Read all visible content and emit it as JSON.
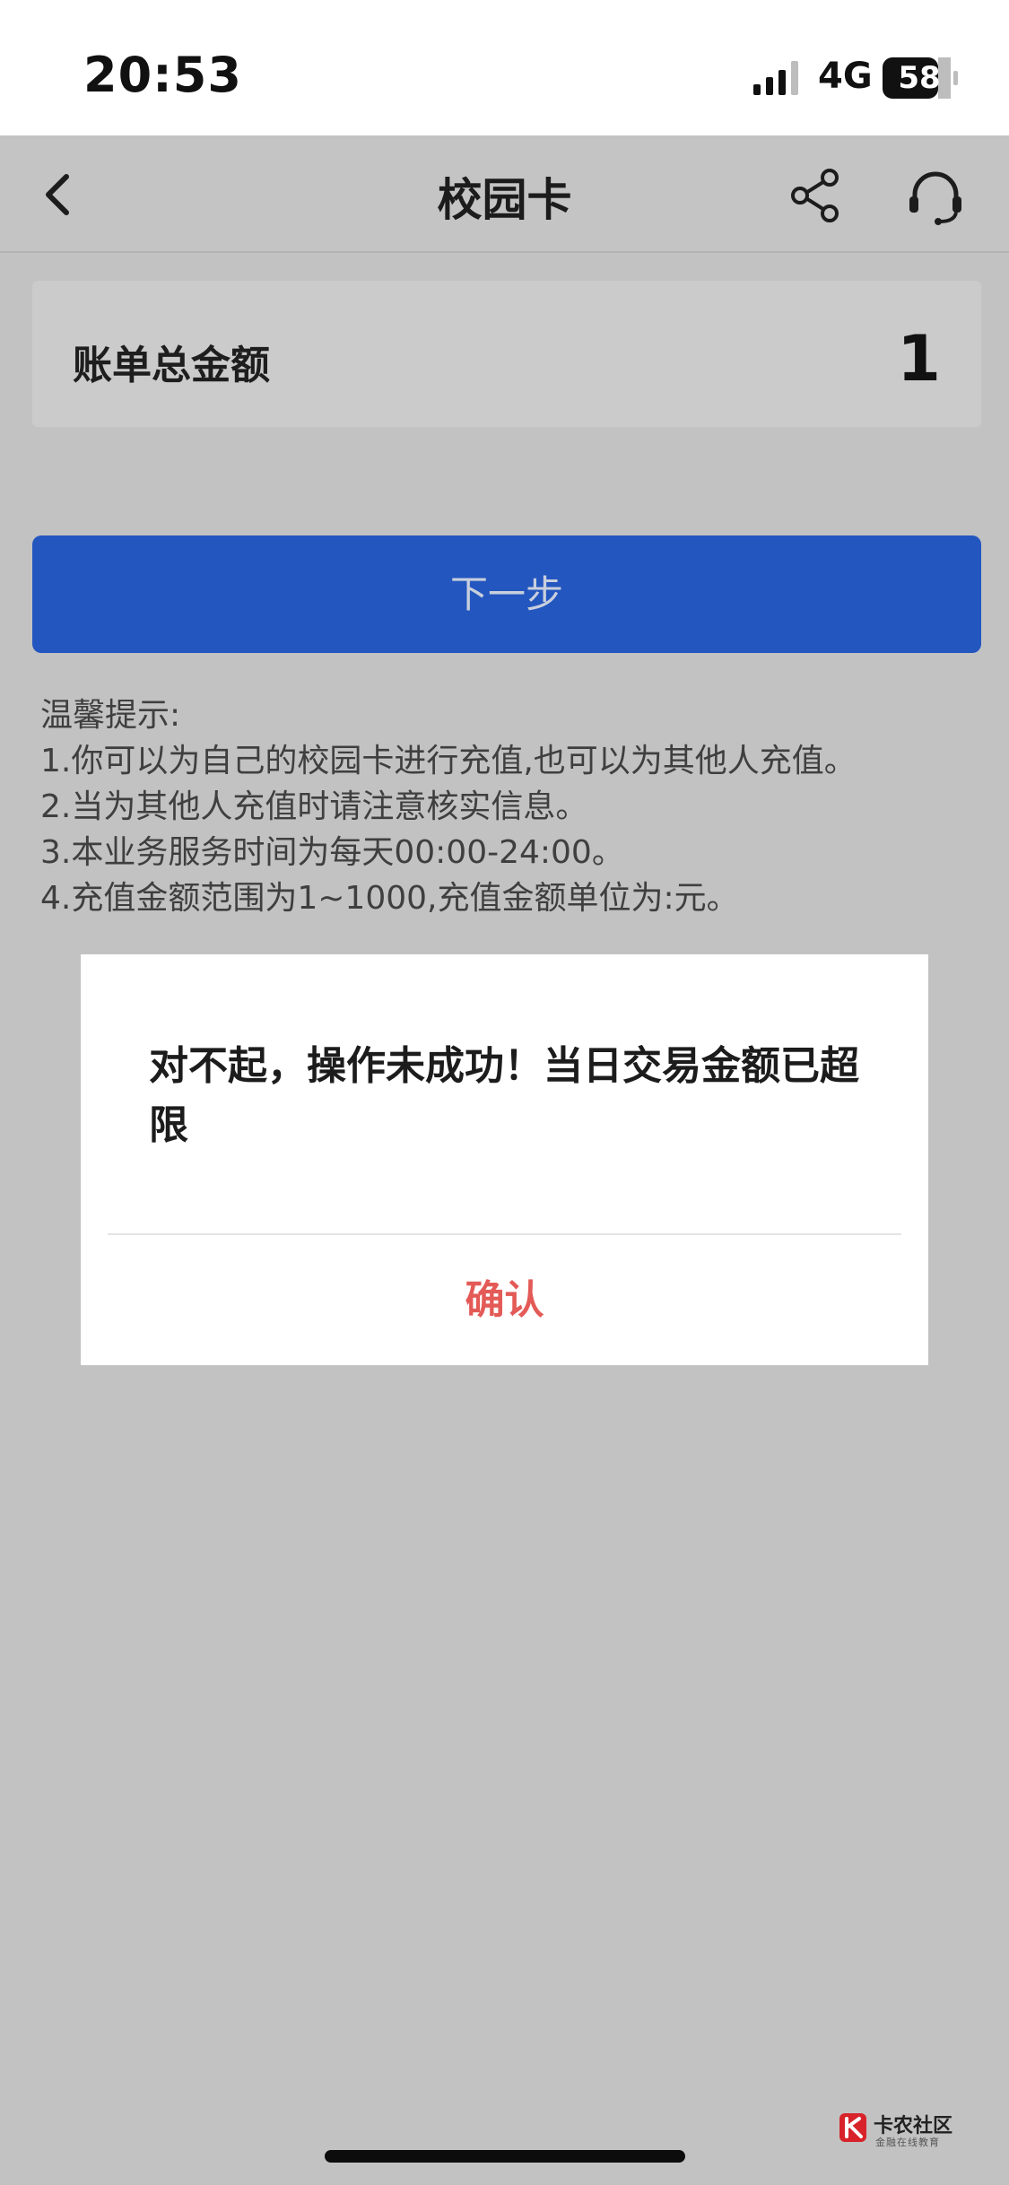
{
  "status_bar": {
    "time": "20:53",
    "network": "4G",
    "battery": "58",
    "icons": [
      "signal-bars-icon",
      "battery-icon"
    ]
  },
  "nav": {
    "title": "校园卡",
    "icons": [
      "back-chevron-icon",
      "share-icon",
      "headset-support-icon"
    ]
  },
  "amount_card": {
    "label": "账单总金额",
    "value": "1"
  },
  "next_button": {
    "label": "下一步",
    "color": "#2356bf"
  },
  "tips": {
    "title": "温馨提示:",
    "lines": [
      "1.你可以为自己的校园卡进行充值,也可以为其他人充值。",
      "2.当为其他人充值时请注意核实信息。",
      "3.本业务服务时间为每天00:00-24:00。",
      "4.充值金额范围为1~1000,充值金额单位为:元。"
    ]
  },
  "dialog": {
    "message": "对不起，操作未成功！当日交易金额已超限",
    "confirm_label": "确认",
    "confirm_color": "#e35a57"
  },
  "watermark": {
    "title": "卡农社区",
    "subtitle": "金融在线教育"
  }
}
